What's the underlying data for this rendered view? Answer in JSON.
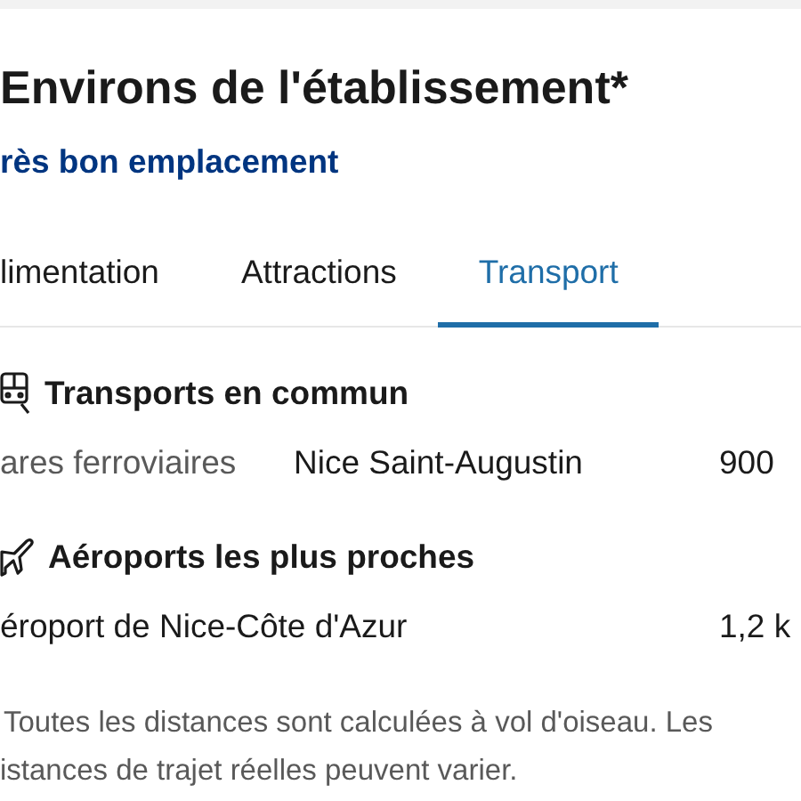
{
  "title": "Environs de l'établissement*",
  "rating_label": "rès bon emplacement",
  "tabs": [
    {
      "label": "limentation",
      "selected": false
    },
    {
      "label": "Attractions",
      "selected": false
    },
    {
      "label": "Transport",
      "selected": true
    }
  ],
  "sections": [
    {
      "kind": "transit",
      "heading": "Transports en commun",
      "rows": [
        {
          "category": "ares ferroviaires",
          "name": "Nice Saint-Augustin",
          "distance": "900"
        }
      ]
    },
    {
      "kind": "airport",
      "heading": "Aéroports les plus proches",
      "rows": [
        {
          "name": "éroport de Nice-Côte d'Azur",
          "distance": "1,2 k"
        }
      ]
    }
  ],
  "note_lines": [
    "Toutes les distances sont calculées à vol d'oiseau. Les",
    "istances de trajet réelles peuvent varier."
  ]
}
